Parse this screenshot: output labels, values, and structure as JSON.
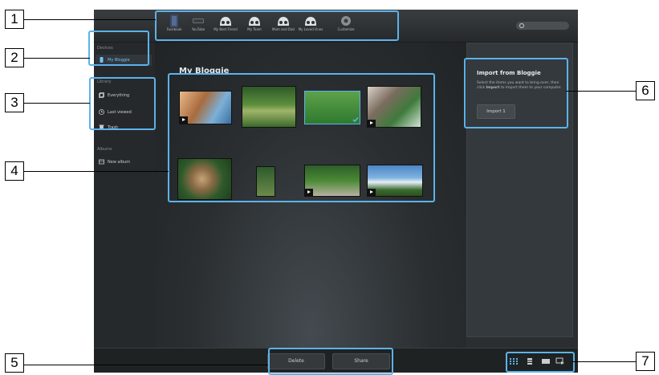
{
  "toolbar": {
    "items": [
      {
        "label": "Facebook",
        "icon": "facebook-icon"
      },
      {
        "label": "YouTube",
        "icon": "youtube-icon"
      },
      {
        "label": "My Best Friend",
        "icon": "people-icon"
      },
      {
        "label": "My Team",
        "icon": "people-icon"
      },
      {
        "label": "Mom and Dad",
        "icon": "people-icon"
      },
      {
        "label": "My Loved Ones",
        "icon": "people-icon"
      },
      {
        "label": "Customize",
        "icon": "customize-icon"
      }
    ],
    "search_icon": "search-icon"
  },
  "sidebar": {
    "devices_title": "Devices",
    "device_item": "My Bloggie",
    "library_title": "Library",
    "library_items": [
      "Everything",
      "Last viewed",
      "Trash"
    ],
    "albums_title": "Albums",
    "album_item": "New album"
  },
  "main": {
    "title": "My Bloggie"
  },
  "right_panel": {
    "title": "Import from Bloggie",
    "desc_1": "Select the items you want to bring over, then click ",
    "desc_bold": "Import",
    "desc_2": " to import them to your computer.",
    "import_button": "Import 1"
  },
  "bottom_bar": {
    "delete_button": "Delete",
    "share_button": "Share",
    "view_icons": [
      "grid-view-icon",
      "list-view-icon",
      "single-view-icon",
      "slideshow-icon"
    ]
  },
  "callouts": [
    "1",
    "2",
    "3",
    "4",
    "5",
    "6",
    "7"
  ],
  "colors": {
    "highlight": "#5bb3ea",
    "selected_text": "#6ec3ff"
  }
}
